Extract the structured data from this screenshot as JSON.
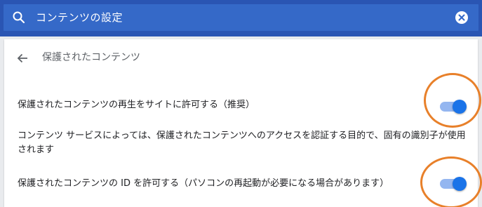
{
  "search": {
    "query": "コンテンツの設定",
    "icon": "search-icon",
    "clear_icon": "clear-icon"
  },
  "header": {
    "back_icon": "arrow-back-icon",
    "title": "保護されたコンテンツ"
  },
  "settings": [
    {
      "label": "保護されたコンテンツの再生をサイトに許可する（推奨）",
      "enabled": true
    },
    {
      "label": "保護されたコンテンツの ID を許可する（パソコンの再起動が必要になる場合があります）",
      "enabled": true
    }
  ],
  "description": "コンテンツ サービスによっては、保護されたコンテンツへのアクセスを認証する目的で、固有の識別子が使用されます",
  "colors": {
    "header_bg": "#2a55b3",
    "search_bg": "#3569c8",
    "toggle_on": "#1a73e8",
    "toggle_track_on": "#94b6f0",
    "annotation": "#e8802a"
  }
}
